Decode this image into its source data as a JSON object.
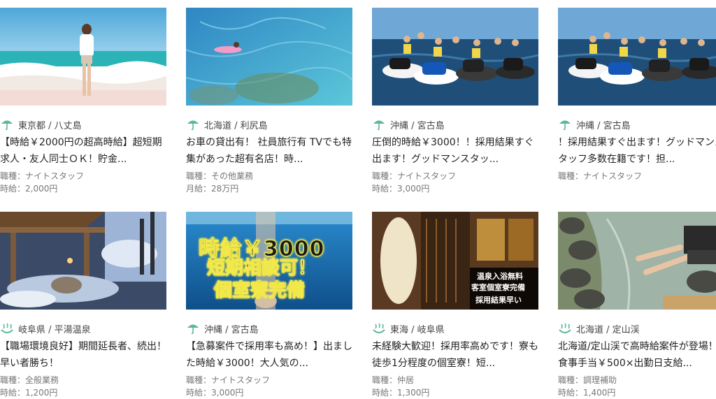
{
  "listings": [
    {
      "location": "東京都 / 八丈島",
      "title": "【時給￥2000円の超高時給】超短期求人・友人同士ＯＫ！貯金...",
      "job": "職種：ナイトスタッフ",
      "pay": "時給：2,000円",
      "icon": "umbrella-icon"
    },
    {
      "location": "北海道 / 利尻島",
      "title": "お車の貸出有！ 社員旅行有 TVでも特集があった超有名店！時...",
      "job": "職種：その他業務",
      "pay": "月給：28万円",
      "icon": "umbrella-icon"
    },
    {
      "location": "沖縄 / 宮古島",
      "title": "圧倒的時給￥3000！！採用結果すぐ出ます！グッドマンスタッ...",
      "job": "職種：ナイトスタッフ",
      "pay": "時給：3,000円",
      "icon": "umbrella-icon"
    },
    {
      "location": "沖縄 / 宮古島",
      "title": "！採用結果すぐ出ます！グッドマンスタッフ多数在籍です！担...",
      "job": "職種：ナイトスタッフ",
      "pay": "",
      "icon": "umbrella-icon"
    },
    {
      "location": "岐阜県 / 平湯温泉",
      "title": "【職場環境良好】期間延長者、続出！早い者勝ち！",
      "job": "職種：全般業務",
      "pay": "時給：1,200円",
      "icon": "hot-spring-icon"
    },
    {
      "location": "沖縄 / 宮古島",
      "title": "【急募案件で採用率も高め！】出ました時給￥3000！大人気の...",
      "job": "職種：ナイトスタッフ",
      "pay": "時給：3,000円",
      "icon": "umbrella-icon",
      "overlay": [
        "時給￥3000",
        "短期相談可！",
        "個室寮完備"
      ]
    },
    {
      "location": "東海 / 岐阜県",
      "title": "未経験大歓迎！採用率高めです！寮も徒歩1分程度の個室寮！短...",
      "job": "職種：仲居",
      "pay": "時給：1,300円",
      "icon": "hot-spring-icon",
      "overlay": [
        "温泉入浴無料",
        "客室個室寮完備",
        "採用結果早い"
      ]
    },
    {
      "location": "北海道 / 定山渓",
      "title": "北海道/定山渓で高時給案件が登場！食事手当￥500×出勤日支給...",
      "job": "職種：調理補助",
      "pay": "時給：1,400円",
      "icon": "hot-spring-icon"
    }
  ],
  "colors": {
    "icon_green": "#5cb89a",
    "text": "#222222",
    "meta": "#777777"
  }
}
